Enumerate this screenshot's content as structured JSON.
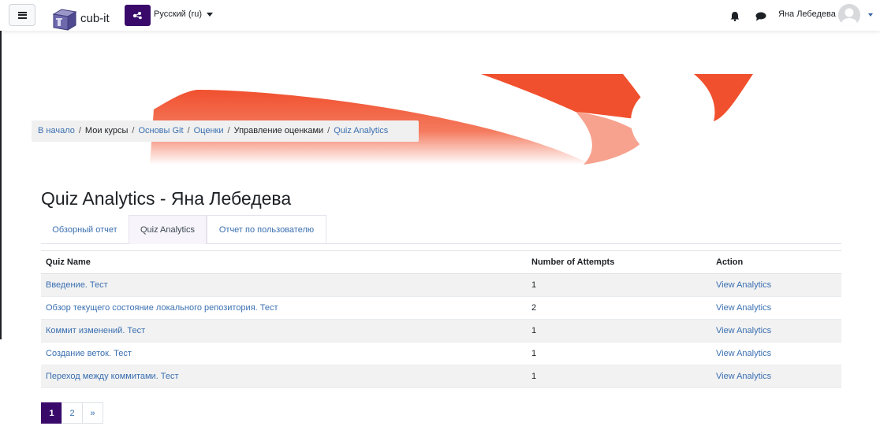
{
  "navbar": {
    "site_name": "cub-it",
    "language_label": "Русский (ru)",
    "user_name": "Яна Лебедева",
    "icons": [
      "hamburger-icon",
      "cube-logo",
      "language-icon",
      "bell-icon",
      "chat-icon",
      "user-avatar"
    ]
  },
  "breadcrumb": {
    "items": [
      {
        "label": "В начало",
        "link": true
      },
      {
        "label": "Мои курсы",
        "link": false
      },
      {
        "label": "Основы Git",
        "link": true
      },
      {
        "label": "Оценки",
        "link": true
      },
      {
        "label": "Управление оценками",
        "link": false
      },
      {
        "label": "Quiz Analytics",
        "link": true
      }
    ]
  },
  "page": {
    "title": "Quiz Analytics - Яна Лебедева"
  },
  "tabs": [
    {
      "label": "Обзорный отчет",
      "active": false
    },
    {
      "label": "Quiz Analytics",
      "active": true
    },
    {
      "label": "Отчет по пользователю",
      "active": false
    }
  ],
  "table": {
    "headers": [
      "Quiz Name",
      "Number of Attempts",
      "Action"
    ],
    "rows": [
      {
        "name": "Введение. Тест",
        "attempts": "1",
        "action": "View Analytics"
      },
      {
        "name": "Обзор текущего состояние локального репозитория. Тест",
        "attempts": "2",
        "action": "View Analytics"
      },
      {
        "name": "Коммит изменений. Тест",
        "attempts": "1",
        "action": "View Analytics"
      },
      {
        "name": "Создание веток. Тест",
        "attempts": "1",
        "action": "View Analytics"
      },
      {
        "name": "Переход между коммитами. Тест",
        "attempts": "1",
        "action": "View Analytics"
      }
    ]
  },
  "pagination": {
    "pages": [
      "1",
      "2"
    ],
    "next": "»",
    "current": "1"
  },
  "colors": {
    "brand": "#3a0a6b",
    "link": "#3a6fb0",
    "banner": "#f05a3a"
  }
}
